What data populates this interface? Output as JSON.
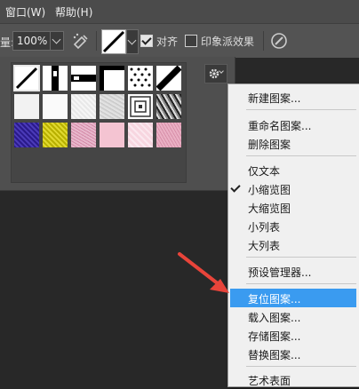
{
  "menubar": {
    "window": "窗口(W)",
    "help": "帮助(H)"
  },
  "options": {
    "flow_label": "量:",
    "flow_value": "100%",
    "align_label": "对齐",
    "align_checked": true,
    "impressionist_label": "印象派效果",
    "impressionist_checked": false
  },
  "patterns": [
    "diagonal-line",
    "vertical-bar",
    "horizontal-bar",
    "square-outline",
    "dots",
    "diagonal-bold",
    "white-paper",
    "white-plain",
    "light-gray-paper",
    "gray-noise",
    "concentric-squares",
    "stone-texture",
    "purple-texture",
    "yellow-texture",
    "pink-noise",
    "light-pink",
    "pink-sparkle",
    "pink-speckle"
  ],
  "menu": {
    "new_pattern": "新建图案...",
    "rename_pattern": "重命名图案...",
    "delete_pattern": "删除图案",
    "text_only": "仅文本",
    "small_thumbnail": "小缩览图",
    "large_thumbnail": "大缩览图",
    "small_list": "小列表",
    "large_list": "大列表",
    "preset_manager": "预设管理器...",
    "reset_patterns": "复位图案...",
    "load_patterns": "载入图案...",
    "save_patterns": "存储图案...",
    "replace_patterns": "替换图案...",
    "cut_item": "艺术表面"
  },
  "accent_colors": {
    "highlight": "#3a9bf0",
    "arrow": "#e8443a"
  }
}
